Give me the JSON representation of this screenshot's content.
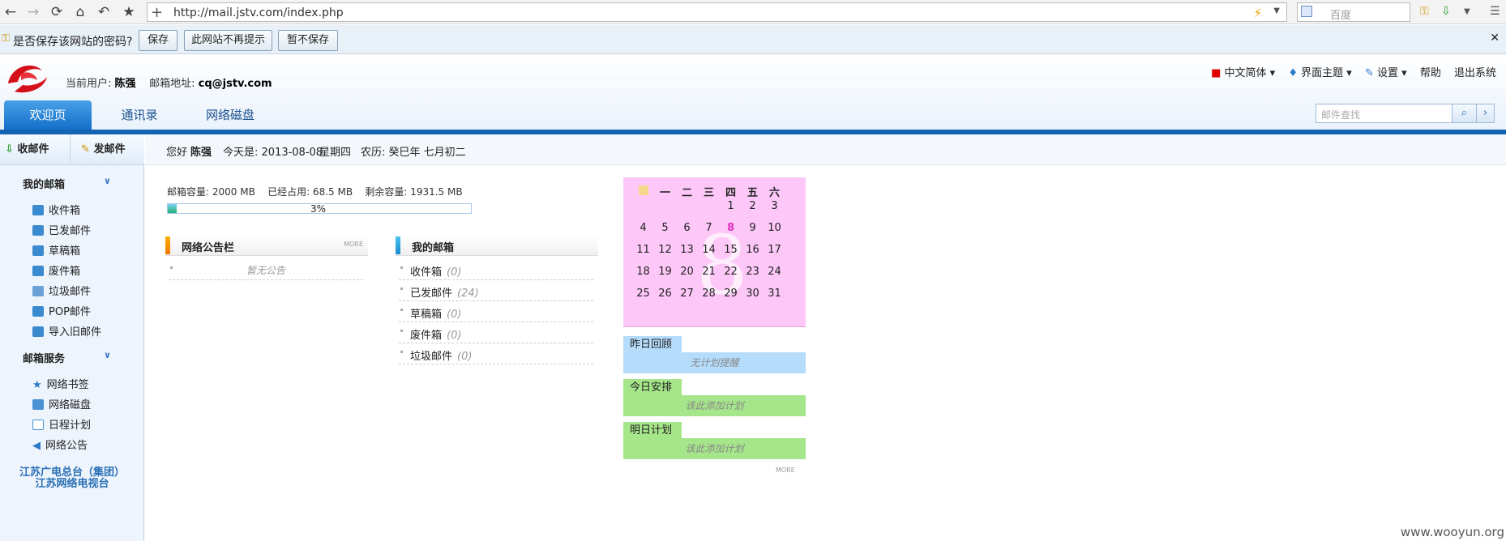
{
  "browser": {
    "url": "http://mail.jstv.com/index.php",
    "search_placeholder": "百度"
  },
  "password_bar": {
    "question": "是否保存该网站的密码?",
    "buttons": [
      "保存",
      "此网站不再提示",
      "暂不保存"
    ]
  },
  "header": {
    "user_label": "当前用户:",
    "user_name": "陈强",
    "email_label": "邮箱地址:",
    "email": "cq@jstv.com",
    "top_links": [
      "中文简体",
      "界面主题",
      "设置",
      "帮助",
      "退出系统"
    ],
    "tabs": [
      "欢迎页",
      "通讯录",
      "网络磁盘"
    ],
    "search_placeholder": "邮件查找"
  },
  "sidebar": {
    "receive": "收邮件",
    "send": "发邮件",
    "my_mailbox_title": "我的邮箱",
    "mailbox_items": [
      "收件箱",
      "已发邮件",
      "草稿箱",
      "废件箱",
      "垃圾邮件",
      "POP邮件",
      "导入旧邮件"
    ],
    "services_title": "邮箱服务",
    "service_items": [
      "网络书签",
      "网络磁盘",
      "日程计划",
      "网络公告"
    ],
    "footer_line1": "江苏广电总台（集团）",
    "footer_line2": "江苏网络电视台"
  },
  "greeting": {
    "hello": "您好",
    "name": "陈强",
    "today": "今天是: 2013-08-08",
    "weekday": "星期四",
    "lunar": "农历: 癸巳年  七月初二"
  },
  "quota": {
    "capacity": "邮箱容量: 2000 MB",
    "used": "已经占用: 68.5 MB",
    "remaining": "剩余容量: 1931.5 MB",
    "percent_text": "3%",
    "percent": 3
  },
  "announcements": {
    "title": "网络公告栏",
    "more": "MORE",
    "empty": "暂无公告"
  },
  "my_mailbox_panel": {
    "title": "我的邮箱",
    "items": [
      {
        "label": "收件箱",
        "count": "(0)"
      },
      {
        "label": "已发邮件",
        "count": "(24)"
      },
      {
        "label": "草稿箱",
        "count": "(0)"
      },
      {
        "label": "废件箱",
        "count": "(0)"
      },
      {
        "label": "垃圾邮件",
        "count": "(0)"
      }
    ]
  },
  "calendar": {
    "big_day": "8",
    "headers": [
      "日",
      "一",
      "二",
      "三",
      "四",
      "五",
      "六"
    ],
    "rows": [
      [
        "",
        "",
        "",
        "",
        "1",
        "2",
        "3"
      ],
      [
        "4",
        "5",
        "6",
        "7",
        "8",
        "9",
        "10"
      ],
      [
        "11",
        "12",
        "13",
        "14",
        "15",
        "16",
        "17"
      ],
      [
        "18",
        "19",
        "20",
        "21",
        "22",
        "23",
        "24"
      ],
      [
        "25",
        "26",
        "27",
        "28",
        "29",
        "30",
        "31"
      ]
    ],
    "today": "8"
  },
  "plans": [
    {
      "tag": "昨日回顾",
      "body": "无计划提醒",
      "color": "#b5dcfb"
    },
    {
      "tag": "今日安排",
      "body": "该此添加计划",
      "color": "#a6e68a"
    },
    {
      "tag": "明日计划",
      "body": "该此添加计划",
      "color": "#a6e68a"
    }
  ],
  "plans_more": "MORE",
  "watermark": "www.wooyun.org"
}
